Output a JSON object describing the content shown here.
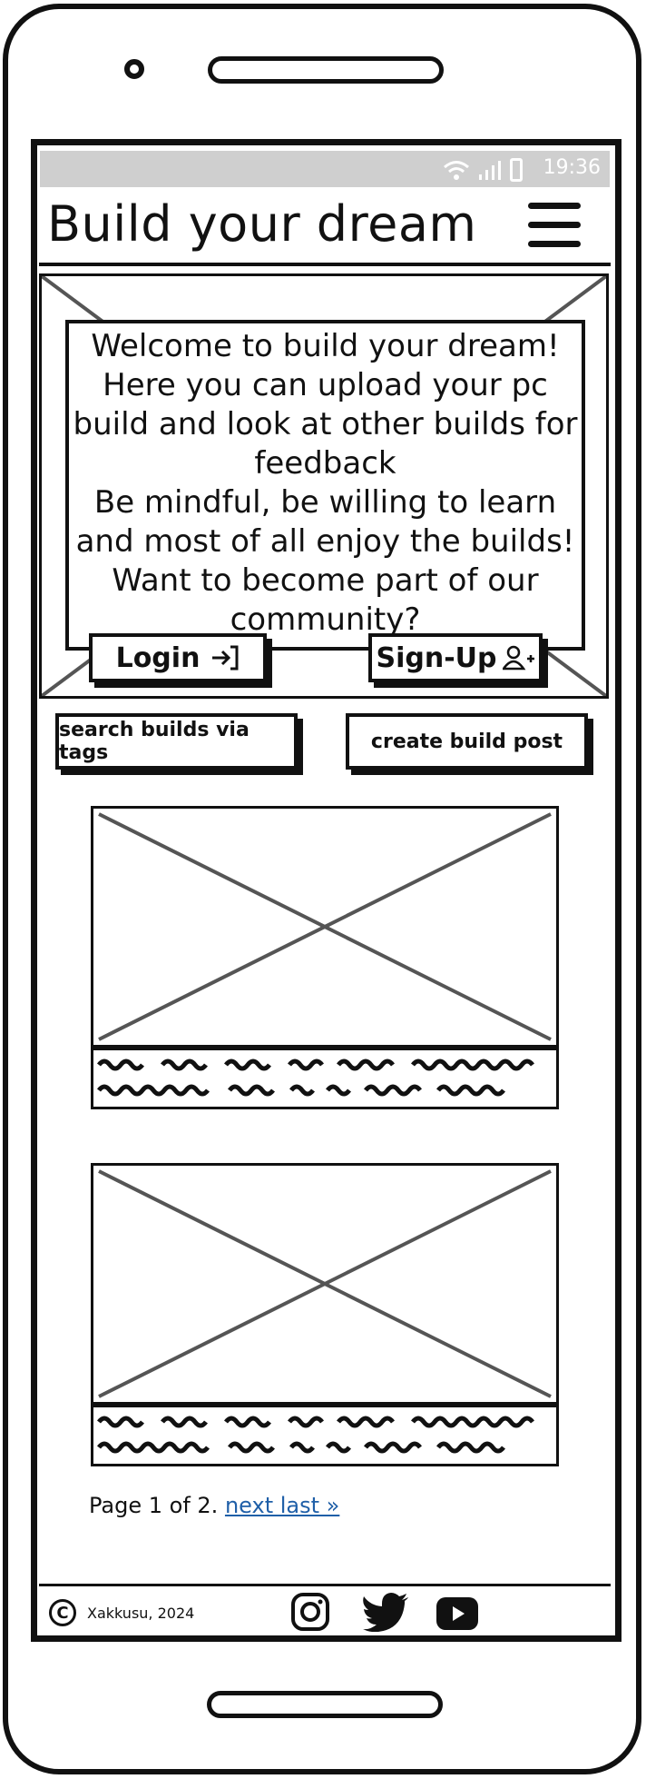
{
  "statusbar": {
    "time": "19:36"
  },
  "header": {
    "title": "Build your dream"
  },
  "hero": {
    "welcome_text": "Welcome to build your dream!\nHere you can upload your pc build and look at other builds for feedback\nBe mindful, be willing to learn and most of all enjoy the builds!\nWant to become part of our community?",
    "login_label": "Login",
    "signup_label": "Sign-Up"
  },
  "actions": {
    "search_tags_label": "search builds via tags",
    "create_post_label": "create build post"
  },
  "pagination": {
    "text": "Page 1 of 2.",
    "link": "next last »"
  },
  "footer": {
    "copyright": "Xakkusu, 2024"
  },
  "icons": [
    "login-icon",
    "add-user-icon",
    "menu-icon",
    "wifi-icon",
    "signal-icon",
    "battery-icon",
    "instagram-icon",
    "twitter-icon",
    "youtube-icon",
    "copyright-icon"
  ]
}
